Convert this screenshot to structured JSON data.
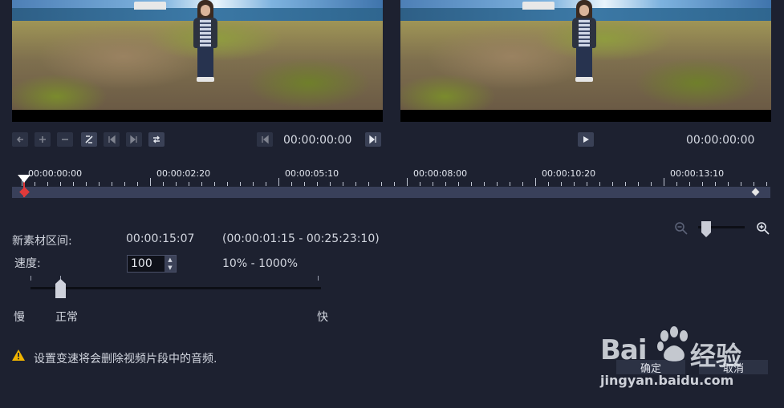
{
  "player": {
    "original_timecode": "00:00:00:00",
    "preview_timecode": "00:00:00:00"
  },
  "timeline": {
    "ruler_labels": [
      "00:00:00:00",
      "00:00:02:20",
      "00:00:05:10",
      "00:00:08:00",
      "00:00:10:20",
      "00:00:13:10"
    ],
    "playhead_fraction": 0.015
  },
  "form": {
    "duration_label": "新素材区间:",
    "duration_value": "00:00:15:07",
    "duration_range": "(00:00:01:15 - 00:25:23:10)",
    "speed_label": "速度:",
    "speed_value": "100",
    "speed_range": "10% - 1000%",
    "slider_slow": "慢",
    "slider_normal": "正常",
    "slider_fast": "快"
  },
  "warning": {
    "text": "设置变速将会删除视频片段中的音频.",
    "icon": "warning-icon",
    "color": "#f0b400"
  },
  "dialog": {
    "ok_label": "确定",
    "cancel_label": "取消"
  },
  "watermark": {
    "logo_text": "Bai",
    "logo_suffix": "经验",
    "url": "jingyan.baidu.com"
  },
  "colors": {
    "background": "#1d2130",
    "track": "#39405a",
    "mark_in": "#e13a3a"
  }
}
